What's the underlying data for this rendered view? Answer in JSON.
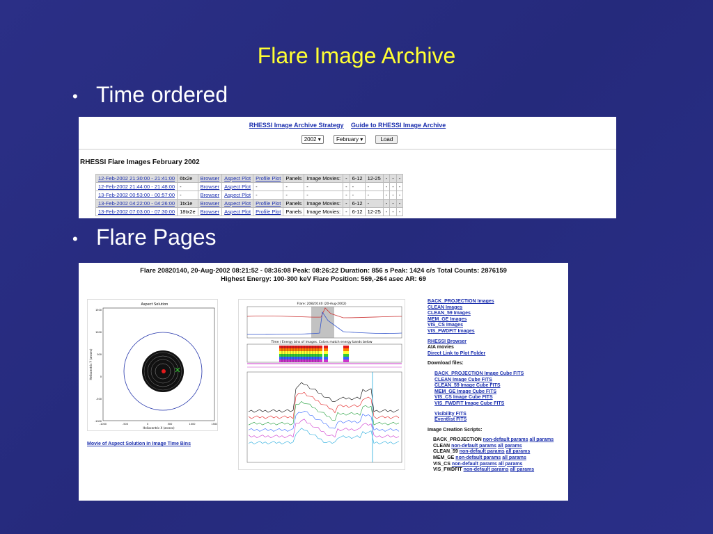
{
  "slide": {
    "title": "Flare Image Archive",
    "bullets": [
      "Time ordered",
      "Flare Pages"
    ]
  },
  "archive": {
    "links": [
      "RHESSI Image Archive Strategy",
      "Guide to RHESSI Image Archive"
    ],
    "year": "2002",
    "month": "February",
    "load": "Load",
    "heading": "RHESSI Flare Images February 2002",
    "rows": [
      [
        "12-Feb-2002 21:30:00 - 21:41:00",
        "6tx2e",
        "Browser",
        "Aspect Plot",
        "Profile Plot",
        "Panels",
        "Image Movies:",
        "-",
        "6-12",
        "12-25",
        "-",
        "-",
        "-"
      ],
      [
        "12-Feb-2002 21:44:00 - 21:48:00",
        "-",
        "Browser",
        "Aspect Plot",
        "-",
        "-",
        "-",
        "-",
        "-",
        "-",
        "-",
        "-",
        "-"
      ],
      [
        "13-Feb-2002 00:53:00 - 00:57:00",
        "-",
        "Browser",
        "Aspect Plot",
        "-",
        "-",
        "-",
        "-",
        "-",
        "-",
        "-",
        "-",
        "-"
      ],
      [
        "13-Feb-2002 04:22:00 - 04:26:00",
        "1tx1e",
        "Browser",
        "Aspect Plot",
        "Profile Plot",
        "Panels",
        "Image Movies:",
        "-",
        "6-12",
        "-",
        "-",
        "-",
        "-"
      ],
      [
        "13-Feb-2002 07:03:00 - 07:30:00",
        "18tx2e",
        "Browser",
        "Aspect Plot",
        "Profile Plot",
        "Panels",
        "Image Movies:",
        "-",
        "6-12",
        "12-25",
        "-",
        "-",
        "-"
      ]
    ]
  },
  "flare": {
    "header1": "Flare 20820140, 20-Aug-2002 08:21:52 - 08:36:08    Peak: 08:26:22    Duration: 856 s    Peak: 1424 c/s    Total Counts: 2876159",
    "header2": "Highest Energy: 100-300 keV   Flare Position: 569,-264  asec   AR: 69",
    "movie_link": "Movie of Aspect Solution in Image Time Bins",
    "aspect_plot": {
      "title": "Aspect Solution",
      "xlabel": "Heliocentric X (arcsec)",
      "ylabel": "Heliocentric Y (arcsec)",
      "xticks": [
        "-1000",
        "-500",
        "0",
        "500",
        "1000",
        "1500"
      ],
      "yticks": [
        "1500",
        "1000",
        "500",
        "0",
        "-500",
        "-1000"
      ]
    },
    "lightcurve": {
      "top_title": "Flare: 20820140 (20-Aug-2002)",
      "mid_title": "Time / Energy bins of images. Colors match energy bands below",
      "colors": [
        "#e31a1c",
        "#ff7f00",
        "#ffff33",
        "#33cc33",
        "#3366ff",
        "#cc33cc"
      ]
    },
    "image_links": [
      "BACK_PROJECTION Images",
      "CLEAN Images",
      "CLEAN_59 Images",
      "MEM_GE Images",
      "VIS_CS Images",
      "VIS_FWDFIT Images"
    ],
    "browser_links": [
      "RHESSI Browser",
      "AIA movies",
      "Direct Link to Plot Folder"
    ],
    "download_label": "Download files:",
    "download_links": [
      "BACK_PROJECTION Image Cube FITS",
      "CLEAN Image Cube FITS",
      "CLEAN_59 Image Cube FITS",
      "MEM_GE Image Cube FITS",
      "VIS_CS Image Cube FITS",
      "VIS_FWDFIT Image Cube FITS"
    ],
    "fits_links": [
      "Visibility FITS",
      "Eventlist FITS"
    ],
    "scripts_label": "Image Creation Scripts:",
    "scripts": [
      {
        "name": "BACK_PROJECTION",
        "nd": "non-default params",
        "all": "all params"
      },
      {
        "name": "CLEAN",
        "nd": "non-default params",
        "all": "all params"
      },
      {
        "name": "CLEAN_59",
        "nd": "non-default params",
        "all": "all params"
      },
      {
        "name": "MEM_GE",
        "nd": "non-default params",
        "all": "all params"
      },
      {
        "name": "VIS_CS",
        "nd": "non-default params",
        "all": "all params"
      },
      {
        "name": "VIS_FWDFIT",
        "nd": "non-default params",
        "all": "all params"
      }
    ]
  }
}
